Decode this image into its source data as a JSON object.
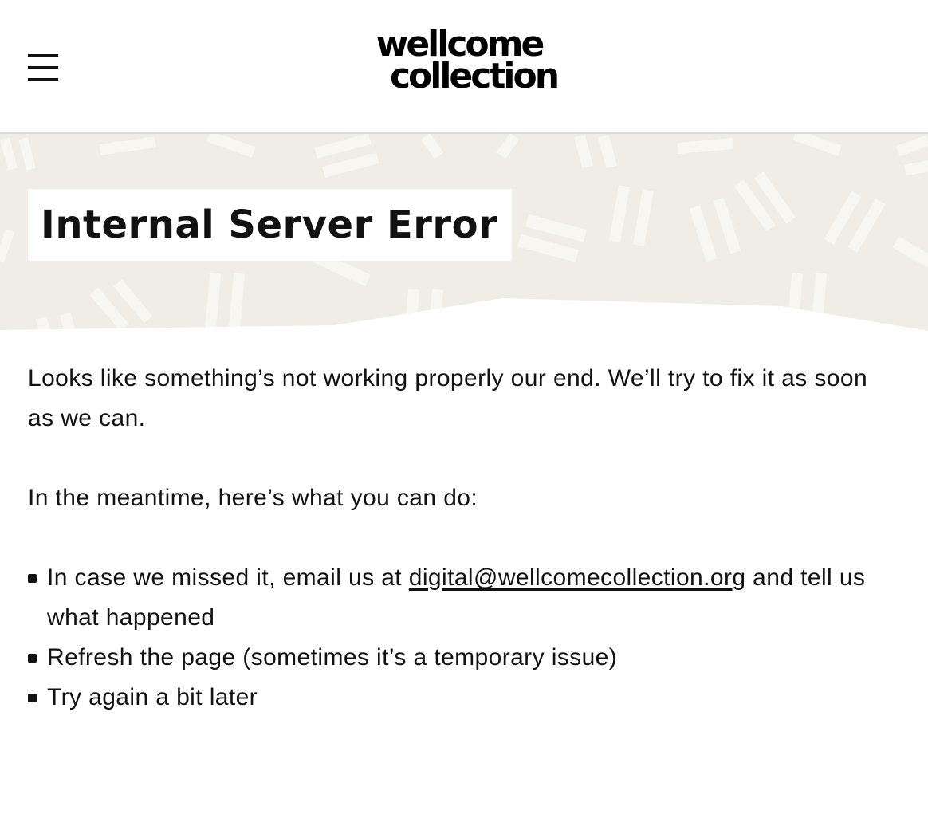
{
  "header": {
    "menu_icon": "hamburger-menu-icon",
    "logo_line1": "wellcome",
    "logo_line2": "collection"
  },
  "hero": {
    "title": "Internal Server Error",
    "background_color": "#efede6"
  },
  "content": {
    "paragraph1": "Looks like something’s not working properly our end. We’ll try to fix it as soon as we can.",
    "paragraph2": "In the meantime, here’s what you can do:",
    "list": {
      "item1_before": "In case we missed it, email us at ",
      "item1_link": "digital@wellcomecollection.org",
      "item1_after": " and tell us what happened",
      "item2": "Refresh the page (sometimes it’s a temporary issue)",
      "item3": "Try again a bit later"
    }
  }
}
